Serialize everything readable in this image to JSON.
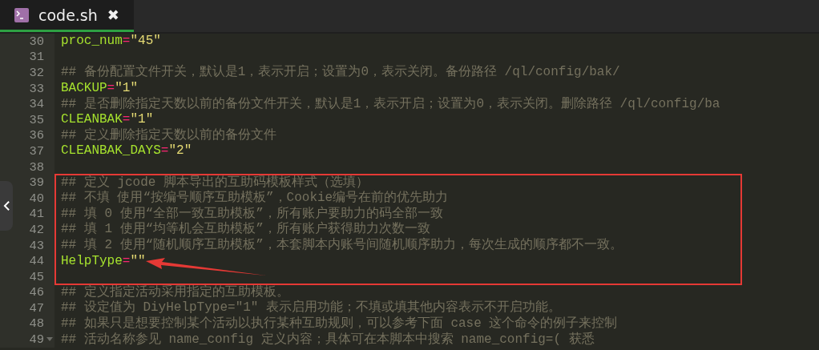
{
  "tab": {
    "title": "code.sh",
    "close": "✖",
    "selected": true
  },
  "blocks": [
    {
      "kind": "plain",
      "lines": [
        {
          "number": "30",
          "kind": "assign",
          "name": "proc_num",
          "op": "=",
          "value": "\"45\"",
          "foldable": false
        },
        {
          "number": "31",
          "kind": "blank",
          "foldable": false
        },
        {
          "number": "32",
          "kind": "comment",
          "text": "## 备份配置文件开关，默认是1，表示开启；设置为0，表示关闭。备份路径 /ql/config/bak/",
          "foldable": false
        },
        {
          "number": "33",
          "kind": "assign",
          "name": "BACKUP",
          "op": "=",
          "value": "\"1\"",
          "foldable": false
        },
        {
          "number": "34",
          "kind": "comment",
          "text": "## 是否删除指定天数以前的备份文件开关，默认是1，表示开启；设置为0，表示关闭。删除路径 /ql/config/ba",
          "foldable": false
        },
        {
          "number": "35",
          "kind": "assign",
          "name": "CLEANBAK",
          "op": "=",
          "value": "\"1\"",
          "foldable": false
        },
        {
          "number": "36",
          "kind": "comment",
          "text": "## 定义删除指定天数以前的备份文件",
          "foldable": false
        },
        {
          "number": "37",
          "kind": "assign",
          "name": "CLEANBAK_DAYS",
          "op": "=",
          "value": "\"2\"",
          "foldable": false
        },
        {
          "number": "38",
          "kind": "blank",
          "foldable": false
        }
      ]
    },
    {
      "kind": "highlight",
      "lines": [
        {
          "number": "39",
          "kind": "comment",
          "text": "## 定义 jcode 脚本导出的互助码模板样式（选填）",
          "foldable": false
        },
        {
          "number": "40",
          "kind": "comment",
          "text": "## 不填 使用“按编号顺序互助模板”，Cookie编号在前的优先助力",
          "foldable": false
        },
        {
          "number": "41",
          "kind": "comment",
          "text": "## 填 0 使用“全部一致互助模板”，所有账户要助力的码全部一致",
          "foldable": false
        },
        {
          "number": "42",
          "kind": "comment",
          "text": "## 填 1 使用“均等机会互助模板”，所有账户获得助力次数一致",
          "foldable": false
        },
        {
          "number": "43",
          "kind": "comment",
          "text": "## 填 2 使用“随机顺序互助模板”，本套脚本内账号间随机顺序助力，每次生成的顺序都不一致。",
          "foldable": false
        },
        {
          "number": "44",
          "kind": "assign",
          "name": "HelpType",
          "op": "=",
          "value": "\"\"",
          "foldable": false
        },
        {
          "number": "45",
          "kind": "blank",
          "foldable": false
        }
      ]
    },
    {
      "kind": "plain",
      "lines": [
        {
          "number": "46",
          "kind": "comment",
          "text": "## 定义指定活动采用指定的互助模板。",
          "foldable": false
        },
        {
          "number": "47",
          "kind": "comment",
          "text": "## 设定值为 DiyHelpType=\"1\" 表示启用功能；不填或填其他内容表示不开启功能。",
          "foldable": false
        },
        {
          "number": "48",
          "kind": "comment",
          "text": "## 如果只是想要控制某个活动以执行某种互助规则，可以参考下面 case 这个命令的例子来控制",
          "foldable": false
        },
        {
          "number": "49",
          "kind": "comment",
          "text": "## 活动名称参见 name_config 定义内容；具体可在本脚本中搜索 name_config=( 获悉",
          "foldable": true
        }
      ]
    }
  ]
}
